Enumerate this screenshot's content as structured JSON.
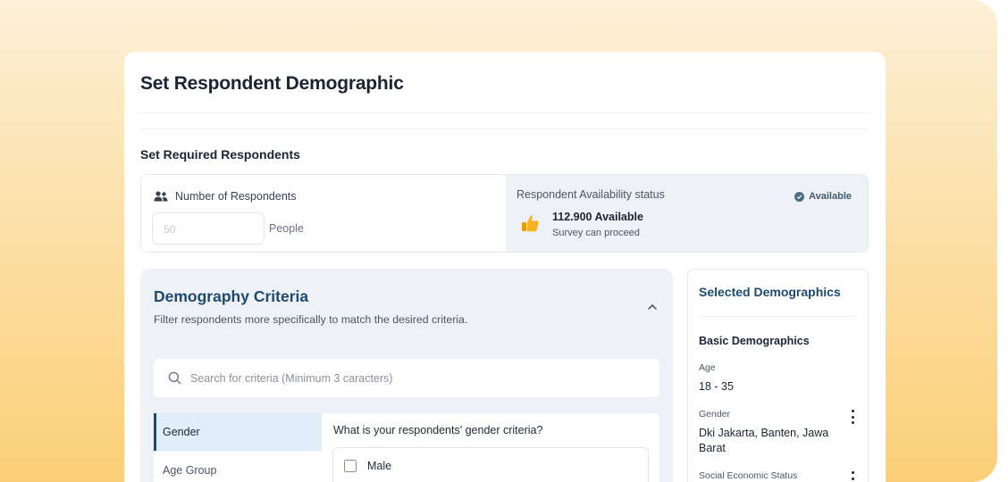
{
  "page": {
    "title": "Set Respondent Demographic"
  },
  "required": {
    "section_title": "Set Required Respondents",
    "number_label": "Number of Respondents",
    "number_placeholder": "50",
    "unit": "People",
    "availability_label": "Respondent Availability status",
    "availability_badge": "Available",
    "available_count": "112.900 Available",
    "available_sub": "Survey can proceed",
    "icons": [
      "users-icon",
      "thumbs-up-icon",
      "check-circle-icon"
    ]
  },
  "criteria": {
    "title": "Demography Criteria",
    "subtitle": "Filter respondents more specifically to match the desired criteria.",
    "search_placeholder": "Search for criteria (Minimum 3 caracters)",
    "tabs": [
      {
        "label": "Gender",
        "active": true
      },
      {
        "label": "Age Group",
        "active": false
      }
    ],
    "question": "What is your respondents' gender criteria?",
    "options": [
      {
        "label": "Male",
        "checked": false
      }
    ]
  },
  "selected": {
    "title": "Selected Demographics",
    "group_title": "Basic Demographics",
    "items": [
      {
        "label": "Age",
        "value": "18 - 35"
      },
      {
        "label": "Gender",
        "value": "Dki Jakarta, Banten, Jawa Barat"
      },
      {
        "label": "Social Economic Status",
        "value": ""
      }
    ]
  },
  "colors": {
    "accent": "#1e4a72",
    "panel_bg": "#eef2f6",
    "gradient_top": "#fdf0d8",
    "gradient_bottom": "#fbcf77"
  }
}
